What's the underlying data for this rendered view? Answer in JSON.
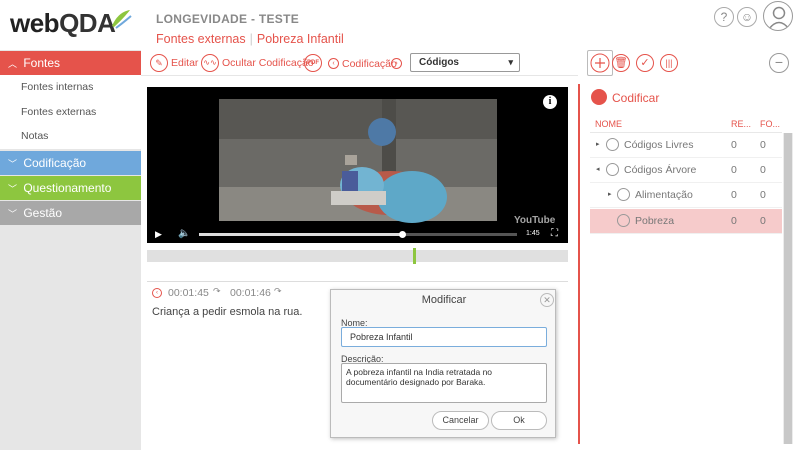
{
  "header": {
    "logo_text_web": "web",
    "logo_text_qda": "QDA",
    "project_title": "LONGEVIDADE - TESTE",
    "breadcrumb": [
      "Fontes externas",
      "Pobreza Infantil"
    ]
  },
  "colors": {
    "accent_red": "#e5534b",
    "codificacao_blue": "#6fa8dc",
    "questionamento_green": "#8dc63f",
    "gestao_gray": "#a8a8a8",
    "selected_row": "#f6cbcb"
  },
  "sidebar": {
    "sections": [
      {
        "label": "Fontes",
        "expanded": true,
        "items": [
          "Fontes internas",
          "Fontes externas",
          "Notas"
        ]
      },
      {
        "label": "Codificação",
        "expanded": false
      },
      {
        "label": "Questionamento",
        "expanded": false
      },
      {
        "label": "Gestão",
        "expanded": false
      }
    ]
  },
  "toolbar": {
    "editar": "Editar",
    "ocultar": "Ocultar Codificação",
    "pdf_icon": "PDF",
    "codificacao": "Codificação",
    "select_value": "Códigos"
  },
  "video": {
    "duration": "1:45",
    "info_icon": "i",
    "watermark": "YouTube"
  },
  "segment": {
    "start": "00:01:45",
    "end": "00:01:46",
    "text": "Criança a pedir esmola na rua."
  },
  "dialog": {
    "title": "Modificar",
    "name_label": "Nome:",
    "name_value": "Pobreza Infantil",
    "desc_label": "Descrição:",
    "desc_value": "A pobreza infantil na India retratada no documentário designado por Baraka.",
    "cancel": "Cancelar",
    "ok": "Ok"
  },
  "panel": {
    "title": "Codificar",
    "columns": [
      "NOME",
      "RE...",
      "FO..."
    ],
    "rows": [
      {
        "label": "Códigos Livres",
        "re": "0",
        "fo": "0",
        "level": 0,
        "expander": "▸"
      },
      {
        "label": "Códigos Árvore",
        "re": "0",
        "fo": "0",
        "level": 0,
        "expander": "◂"
      },
      {
        "label": "Alimentação",
        "re": "0",
        "fo": "0",
        "level": 1,
        "expander": "▸"
      },
      {
        "label": "Pobreza",
        "re": "0",
        "fo": "0",
        "level": 2,
        "expander": ""
      }
    ]
  }
}
